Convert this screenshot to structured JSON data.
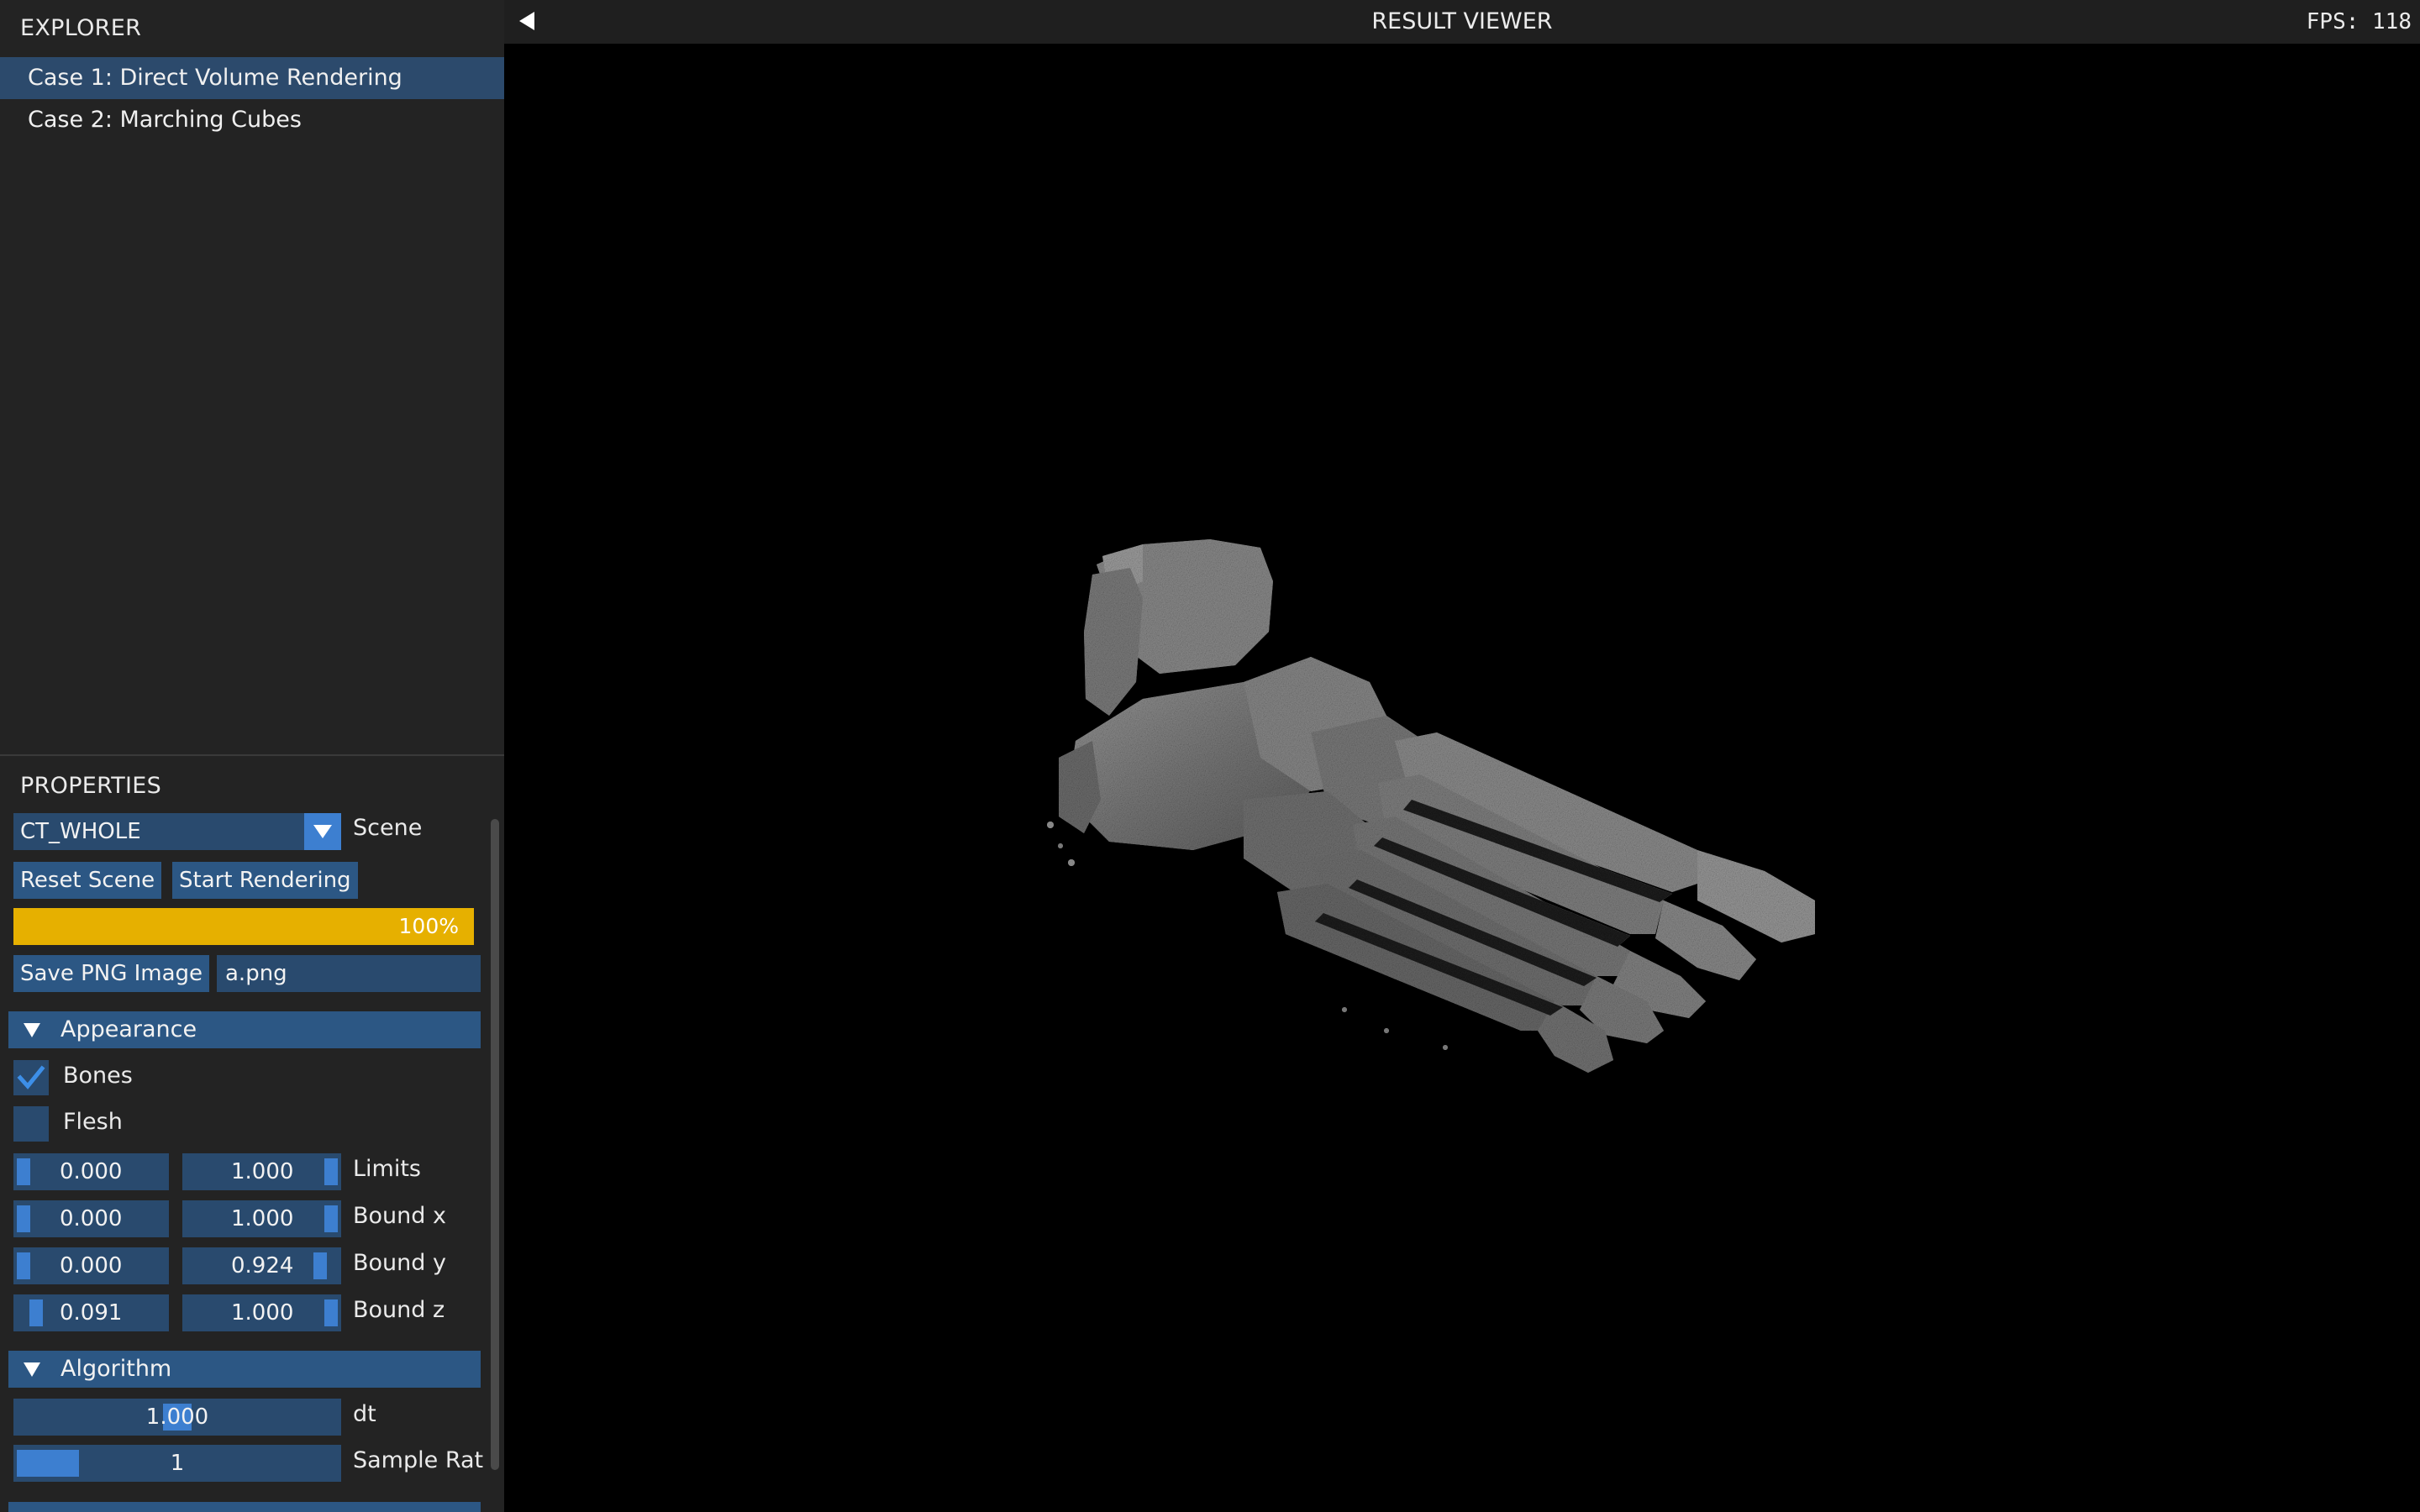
{
  "explorer": {
    "title": "EXPLORER",
    "items": [
      {
        "label": "Case 1: Direct Volume Rendering",
        "selected": true
      },
      {
        "label": "Case 2: Marching Cubes",
        "selected": false
      }
    ]
  },
  "properties": {
    "title": "PROPERTIES",
    "scene_combo": {
      "value": "CT_WHOLE",
      "label": "Scene"
    },
    "buttons": {
      "reset": "Reset Scene",
      "start": "Start Rendering"
    },
    "progress": {
      "text": "100%",
      "fraction": 1.0,
      "color": "#e6b000"
    },
    "save": {
      "button": "Save PNG Image",
      "filename": "a.png"
    },
    "appearance": {
      "header": "Appearance",
      "bones": {
        "label": "Bones",
        "checked": true
      },
      "flesh": {
        "label": "Flesh",
        "checked": false
      },
      "ranges": [
        {
          "label": "Limits",
          "min": "0.000",
          "max": "1.000",
          "min_frac": 0.0,
          "max_frac": 1.0
        },
        {
          "label": "Bound x",
          "min": "0.000",
          "max": "1.000",
          "min_frac": 0.0,
          "max_frac": 1.0
        },
        {
          "label": "Bound y",
          "min": "0.000",
          "max": "0.924",
          "min_frac": 0.0,
          "max_frac": 0.924
        },
        {
          "label": "Bound z",
          "min": "0.091",
          "max": "1.000",
          "min_frac": 0.091,
          "max_frac": 1.0
        }
      ]
    },
    "algorithm": {
      "header": "Algorithm",
      "dt": {
        "label": "dt",
        "value": "1.000"
      },
      "sample_rate": {
        "label": "Sample Rat",
        "value": "1"
      }
    }
  },
  "viewer": {
    "title": "RESULT VIEWER",
    "fps": "FPS: 118",
    "image": "foot-bones-volume-render"
  },
  "colors": {
    "accent": "#3d7fd0",
    "frame": "#294a6e",
    "button": "#2c5784",
    "selected": "#2c4a6c"
  }
}
